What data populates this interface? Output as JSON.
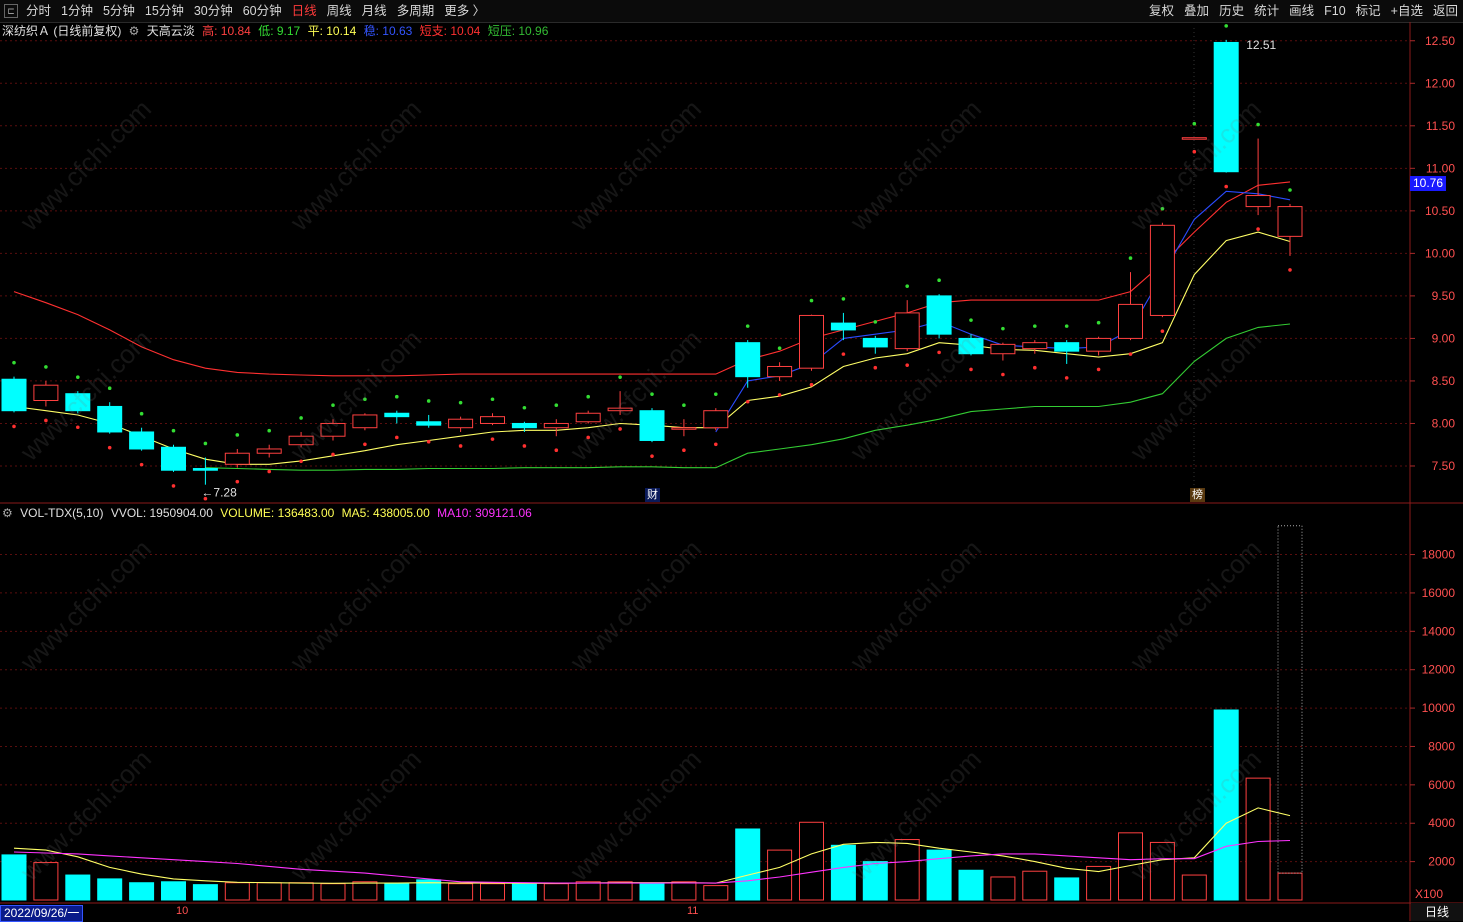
{
  "toolbar": {
    "periods": [
      "分时",
      "1分钟",
      "5分钟",
      "15分钟",
      "30分钟",
      "60分钟",
      "日线",
      "周线",
      "月线",
      "多周期",
      "更多 〉"
    ],
    "active_period": "日线",
    "right_items": [
      "复权",
      "叠加",
      "历史",
      "统计",
      "画线",
      "F10",
      "标记",
      "+自选",
      "返回"
    ]
  },
  "main_legend": {
    "stock": "深纺织Ａ (日线前复权)",
    "indicator": "天高云淡",
    "high_label": "高: 10.84",
    "low_label": "低: 9.17",
    "flat_label": "平: 10.14",
    "blue_label": "稳: 10.63",
    "support_label": "短支: 10.04",
    "pressure_label": "短压: 10.96"
  },
  "volume_legend": {
    "name": "VOL-TDX(5,10)",
    "vvol": "VVOL: 1950904.00",
    "volume": "VOLUME: 136483.00",
    "ma5": "MA5: 438005.00",
    "ma10": "MA10: 309121.06"
  },
  "price_axis": [
    "12.50",
    "12.00",
    "11.50",
    "11.00",
    "10.50",
    "10.00",
    "9.50",
    "9.00",
    "8.50",
    "8.00",
    "7.50"
  ],
  "volume_axis": [
    "18000",
    "16000",
    "14000",
    "12000",
    "10000",
    "8000",
    "6000",
    "4000",
    "2000"
  ],
  "volume_unit": "X100",
  "current_price": "10.76",
  "max_label": "12.51",
  "min_label": "←7.28",
  "markers": {
    "cai": "财",
    "bang": "榜"
  },
  "dates": {
    "start": "2022/09/26/一",
    "m10": "10",
    "m11": "11"
  },
  "period_button": "日线",
  "watermark": "www.cfchi.com",
  "colors": {
    "up": "#ff4040",
    "down": "#00ffff",
    "ma_yellow": "#ffff66",
    "ma_blue": "#2a4bff",
    "ma_red": "#ff3030",
    "ma_green": "#33cc33",
    "vol_ma10": "#ff33ff"
  },
  "chart_data": {
    "type": "candlestick",
    "candles": [
      {
        "o": 8.52,
        "c": 8.15,
        "h": 8.55,
        "l": 8.13
      },
      {
        "o": 8.27,
        "c": 8.45,
        "h": 8.5,
        "l": 8.2
      },
      {
        "o": 8.35,
        "c": 8.15,
        "h": 8.38,
        "l": 8.12
      },
      {
        "o": 8.2,
        "c": 7.9,
        "h": 8.25,
        "l": 7.88
      },
      {
        "o": 7.9,
        "c": 7.7,
        "h": 7.95,
        "l": 7.68
      },
      {
        "o": 7.72,
        "c": 7.45,
        "h": 7.75,
        "l": 7.43
      },
      {
        "o": 7.47,
        "c": 7.45,
        "h": 7.6,
        "l": 7.28
      },
      {
        "o": 7.52,
        "c": 7.65,
        "h": 7.7,
        "l": 7.48
      },
      {
        "o": 7.65,
        "c": 7.7,
        "h": 7.75,
        "l": 7.6
      },
      {
        "o": 7.75,
        "c": 7.85,
        "h": 7.9,
        "l": 7.72
      },
      {
        "o": 7.85,
        "c": 8.0,
        "h": 8.05,
        "l": 7.8
      },
      {
        "o": 7.95,
        "c": 8.1,
        "h": 8.12,
        "l": 7.92
      },
      {
        "o": 8.12,
        "c": 8.08,
        "h": 8.15,
        "l": 8.0
      },
      {
        "o": 8.02,
        "c": 7.98,
        "h": 8.1,
        "l": 7.95
      },
      {
        "o": 7.95,
        "c": 8.05,
        "h": 8.08,
        "l": 7.9
      },
      {
        "o": 8.0,
        "c": 8.08,
        "h": 8.12,
        "l": 7.98
      },
      {
        "o": 8.0,
        "c": 7.95,
        "h": 8.02,
        "l": 7.9
      },
      {
        "o": 7.95,
        "c": 8.0,
        "h": 8.05,
        "l": 7.85
      },
      {
        "o": 8.02,
        "c": 8.12,
        "h": 8.15,
        "l": 8.0
      },
      {
        "o": 8.15,
        "c": 8.18,
        "h": 8.38,
        "l": 8.1
      },
      {
        "o": 8.15,
        "c": 7.8,
        "h": 8.18,
        "l": 7.78
      },
      {
        "o": 7.95,
        "c": 7.95,
        "h": 8.05,
        "l": 7.85
      },
      {
        "o": 7.95,
        "c": 8.15,
        "h": 8.18,
        "l": 7.92
      },
      {
        "o": 8.95,
        "c": 8.55,
        "h": 8.98,
        "l": 8.42
      },
      {
        "o": 8.55,
        "c": 8.67,
        "h": 8.72,
        "l": 8.5
      },
      {
        "o": 8.65,
        "c": 9.27,
        "h": 9.28,
        "l": 8.62
      },
      {
        "o": 9.18,
        "c": 9.1,
        "h": 9.3,
        "l": 8.98
      },
      {
        "o": 9.0,
        "c": 8.9,
        "h": 9.03,
        "l": 8.82
      },
      {
        "o": 8.88,
        "c": 9.3,
        "h": 9.45,
        "l": 8.85
      },
      {
        "o": 9.5,
        "c": 9.05,
        "h": 9.52,
        "l": 9.0
      },
      {
        "o": 9.0,
        "c": 8.82,
        "h": 9.05,
        "l": 8.8
      },
      {
        "o": 8.82,
        "c": 8.93,
        "h": 8.95,
        "l": 8.74
      },
      {
        "o": 8.88,
        "c": 8.95,
        "h": 8.98,
        "l": 8.82
      },
      {
        "o": 8.95,
        "c": 8.85,
        "h": 8.98,
        "l": 8.7
      },
      {
        "o": 8.85,
        "c": 9.0,
        "h": 9.02,
        "l": 8.8
      },
      {
        "o": 9.0,
        "c": 9.4,
        "h": 9.78,
        "l": 8.98
      },
      {
        "o": 9.27,
        "c": 10.33,
        "h": 10.36,
        "l": 9.25
      },
      {
        "o": 11.36,
        "c": 11.36,
        "h": 11.36,
        "l": 11.36
      },
      {
        "o": 12.48,
        "c": 10.96,
        "h": 12.51,
        "l": 10.95
      },
      {
        "o": 10.55,
        "c": 10.68,
        "h": 11.35,
        "l": 10.45
      },
      {
        "o": 10.2,
        "c": 10.55,
        "h": 10.58,
        "l": 9.97
      }
    ],
    "volumes": [
      2350,
      1950,
      1300,
      1100,
      900,
      950,
      800,
      900,
      900,
      900,
      850,
      950,
      850,
      1050,
      850,
      850,
      850,
      850,
      950,
      950,
      850,
      950,
      750,
      3700,
      2600,
      4050,
      2850,
      2000,
      3150,
      2600,
      1550,
      1200,
      1500,
      1150,
      1750,
      3500,
      3000,
      1300,
      9900,
      6350,
      1400
    ],
    "vol_ma5": [
      2700,
      2600,
      2250,
      1700,
      1350,
      1100,
      1000,
      920,
      900,
      880,
      870,
      880,
      880,
      900,
      880,
      880,
      870,
      870,
      890,
      900,
      900,
      900,
      880,
      1300,
      1700,
      2400,
      2900,
      3000,
      2950,
      2700,
      2500,
      2300,
      2000,
      1650,
      1480,
      1800,
      2100,
      2200,
      4000,
      4800,
      4400
    ],
    "vol_ma10": [
      2500,
      2450,
      2400,
      2300,
      2200,
      2100,
      2000,
      1900,
      1750,
      1600,
      1500,
      1400,
      1250,
      1100,
      950,
      920,
      900,
      880,
      880,
      880,
      880,
      890,
      880,
      1000,
      1200,
      1450,
      1700,
      1900,
      2000,
      2150,
      2300,
      2400,
      2400,
      2300,
      2200,
      2100,
      2150,
      2150,
      2800,
      3050,
      3100
    ],
    "ma_yellow": [
      8.2,
      8.15,
      8.1,
      8.0,
      7.85,
      7.7,
      7.58,
      7.52,
      7.52,
      7.56,
      7.62,
      7.68,
      7.75,
      7.8,
      7.85,
      7.9,
      7.92,
      7.92,
      7.95,
      8.0,
      7.98,
      7.95,
      7.95,
      8.27,
      8.32,
      8.43,
      8.67,
      8.77,
      8.82,
      8.95,
      8.92,
      8.87,
      8.86,
      8.82,
      8.78,
      8.82,
      8.95,
      9.75,
      10.15,
      10.25,
      10.14
    ],
    "ma_blue": [
      null,
      null,
      null,
      null,
      null,
      null,
      null,
      null,
      null,
      null,
      null,
      null,
      null,
      null,
      null,
      null,
      null,
      null,
      null,
      null,
      null,
      null,
      7.9,
      8.5,
      8.56,
      8.7,
      9.0,
      9.05,
      9.1,
      9.2,
      9.05,
      8.92,
      8.9,
      8.88,
      8.9,
      9.1,
      9.75,
      10.4,
      10.73,
      10.7,
      10.63
    ],
    "ma_red": [
      9.55,
      9.42,
      9.28,
      9.1,
      8.9,
      8.75,
      8.65,
      8.6,
      8.58,
      8.57,
      8.56,
      8.56,
      8.56,
      8.57,
      8.58,
      8.58,
      8.58,
      8.58,
      8.58,
      8.58,
      8.58,
      8.58,
      8.58,
      8.75,
      8.85,
      9.0,
      9.1,
      9.2,
      9.3,
      9.42,
      9.45,
      9.45,
      9.45,
      9.45,
      9.45,
      9.55,
      9.88,
      10.25,
      10.6,
      10.8,
      10.84
    ],
    "ma_green": [
      null,
      null,
      null,
      null,
      null,
      null,
      7.48,
      7.47,
      7.46,
      7.45,
      7.45,
      7.46,
      7.46,
      7.47,
      7.47,
      7.47,
      7.48,
      7.48,
      7.48,
      7.49,
      7.49,
      7.48,
      7.48,
      7.65,
      7.7,
      7.75,
      7.82,
      7.92,
      7.98,
      8.05,
      8.14,
      8.17,
      8.2,
      8.2,
      8.2,
      8.25,
      8.35,
      8.73,
      9.0,
      9.13,
      9.17
    ],
    "price_range": [
      7.1,
      12.65
    ],
    "volume_range": [
      0,
      19800
    ]
  }
}
